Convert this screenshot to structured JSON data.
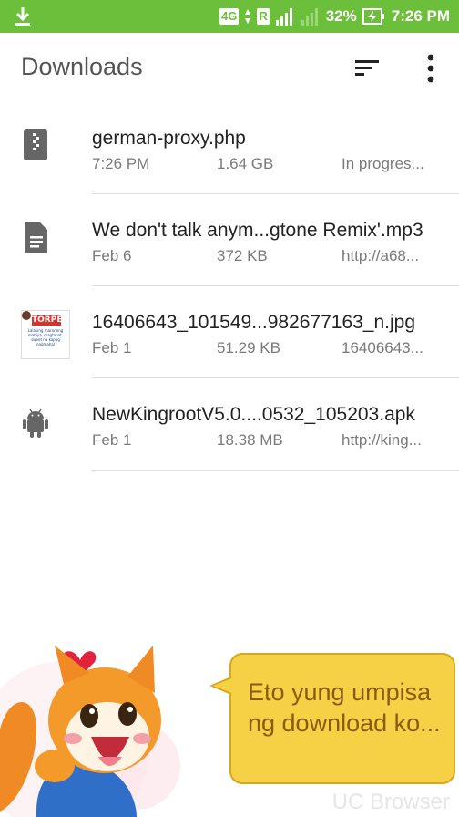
{
  "status_bar": {
    "network_badge": "4G",
    "roaming_badge": "R",
    "battery_percent": "32%",
    "time": "7:26 PM"
  },
  "app_bar": {
    "title": "Downloads"
  },
  "downloads": [
    {
      "name": "german-proxy.php",
      "date": "7:26 PM",
      "size": "1.64 GB",
      "extra": "In progres...",
      "icon": "zip-icon"
    },
    {
      "name": "We don't talk anym...gtone Remix'.mp3",
      "date": "Feb 6",
      "size": "372 KB",
      "extra": "http://a68...",
      "icon": "document-icon"
    },
    {
      "name": "16406643_101549...982677163_n.jpg",
      "date": "Feb 1",
      "size": "51.29 KB",
      "extra": "16406643...",
      "icon": "image-thumbnail"
    },
    {
      "name": "NewKingrootV5.0....0532_105203.apk",
      "date": "Feb 1",
      "size": "18.38 MB",
      "extra": "http://king...",
      "icon": "android-icon"
    }
  ],
  "thumbnail": {
    "heading": "TORPE",
    "caption": "Lalaking marunong mahiya, magtapat, sweet na kapag nagmahal"
  },
  "bubble": {
    "text": "Eto yung umpisa ng download ko..."
  },
  "watermark": "UC Browser",
  "colors": {
    "status_bar": "#6cbf3a",
    "bubble": "#f7d145",
    "bubble_text": "#8a5a10"
  }
}
